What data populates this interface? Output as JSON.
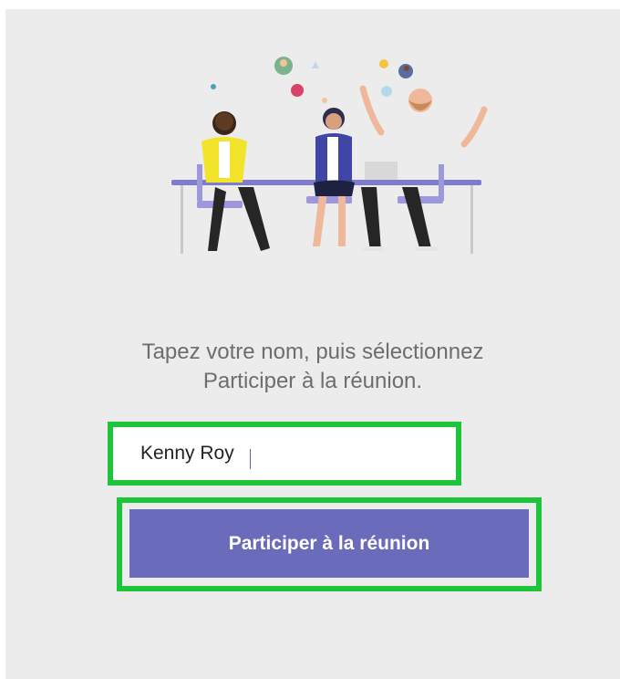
{
  "prompt": {
    "line1": "Tapez votre nom, puis sélectionnez",
    "line2": "Participer à la réunion."
  },
  "name_field": {
    "value": "Kenny Roy"
  },
  "join_button": {
    "label": "Participer à la réunion"
  },
  "colors": {
    "background": "#ececec",
    "button": "#6b6bbb",
    "highlight": "#1ec43a",
    "text": "#6d6d6d"
  },
  "illustration": {
    "icon": "meeting-illustration-icon"
  }
}
